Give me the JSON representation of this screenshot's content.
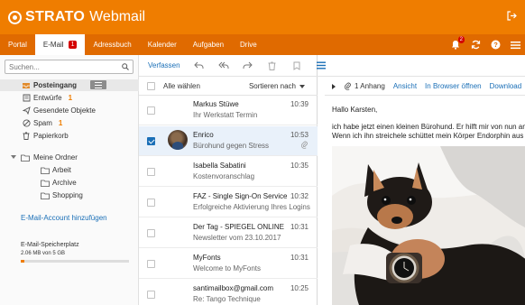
{
  "header": {
    "brand": "STRATO",
    "product": "Webmail",
    "background": "#ef7d00"
  },
  "nav": {
    "items": [
      {
        "label": "Portal"
      },
      {
        "label": "E-Mail",
        "badge": "1",
        "active": true
      },
      {
        "label": "Adressbuch"
      },
      {
        "label": "Kalender"
      },
      {
        "label": "Aufgaben"
      },
      {
        "label": "Drive"
      }
    ],
    "notifications_badge": "2",
    "icons": [
      "bell-icon",
      "refresh-icon",
      "help-icon",
      "menu-icon"
    ]
  },
  "sidebar": {
    "search_placeholder": "Suchen...",
    "folders": [
      {
        "label": "Posteingang",
        "icon": "inbox-icon",
        "selected": true
      },
      {
        "label": "Entwürfe",
        "icon": "drafts-icon",
        "count": "1"
      },
      {
        "label": "Gesendete Objekte",
        "icon": "sent-icon"
      },
      {
        "label": "Spam",
        "icon": "spam-icon",
        "count": "1"
      },
      {
        "label": "Papierkorb",
        "icon": "trash-icon"
      }
    ],
    "my_folders": {
      "label": "Meine Ordner",
      "children": [
        {
          "label": "Arbeit"
        },
        {
          "label": "Archive"
        },
        {
          "label": "Shopping"
        }
      ]
    },
    "account_link": "E-Mail-Account hinzufügen",
    "storage": {
      "title": "E-Mail-Speicherplatz",
      "value": "2.06 MB von 5 GB",
      "fraction": 0.03
    }
  },
  "toolbar": {
    "compose": "Verfassen",
    "buttons": [
      "reply-icon",
      "reply-all-icon",
      "forward-icon",
      "delete-icon",
      "flag-icon",
      "view-options-icon"
    ]
  },
  "list": {
    "select_all": "Alle wählen",
    "sort": "Sortieren nach",
    "messages": [
      {
        "from": "Markus Stüwe",
        "subject": "Ihr Werkstatt Termin",
        "time": "10:39"
      },
      {
        "from": "Enrico",
        "subject": "Bürohund gegen Stress",
        "time": "10:53",
        "selected": true,
        "attachment": true,
        "avatar": true
      },
      {
        "from": "Isabella Sabatini",
        "subject": "Kostenvoranschlag",
        "time": "10:35"
      },
      {
        "from": "FAZ - Single Sign-On Service",
        "subject": "Erfolgreiche Aktivierung Ihres Logins",
        "time": "10:32"
      },
      {
        "from": "Der Tag - SPIEGEL ONLINE",
        "subject": "Newsletter vom 23.10.2017",
        "time": "10:31"
      },
      {
        "from": "MyFonts",
        "subject": "Welcome to MyFonts",
        "time": "10:31"
      },
      {
        "from": "santimailbox@gmail.com",
        "subject": "Re: Tango Technique",
        "time": "10:25"
      }
    ]
  },
  "reading": {
    "attachments": "1 Anhang",
    "view": "Ansicht",
    "open_browser": "In Browser öffnen",
    "download": "Download",
    "greeting": "Hallo Karsten,",
    "line1": "ich habe jetzt einen kleinen Bürohund. Er hilft mir von nun an",
    "line2": "Wenn ich ihn streichele schüttet mein Körper Endorphin aus"
  }
}
